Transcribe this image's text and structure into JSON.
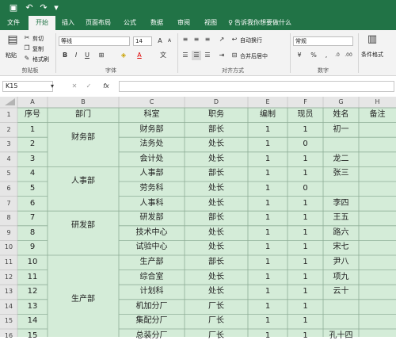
{
  "app": {
    "quick_access": {
      "save_icon": "save-icon",
      "undo_icon": "undo-icon",
      "redo_icon": "redo-icon",
      "customize_icon": "customize-icon"
    }
  },
  "menu": {
    "tabs": [
      "文件",
      "开始",
      "插入",
      "页面布局",
      "公式",
      "数据",
      "审阅",
      "视图"
    ],
    "active": "开始",
    "tellme": "告诉我你想要做什么"
  },
  "ribbon": {
    "clipboard": {
      "paste": "粘贴",
      "cut": "剪切",
      "copy": "复制",
      "painter": "格式刷",
      "label": "剪贴板"
    },
    "font": {
      "name": "等线",
      "size": "14",
      "label": "字体"
    },
    "alignment": {
      "wrap": "自动换行",
      "merge": "合并后居中",
      "label": "对齐方式"
    },
    "number": {
      "format": "常规",
      "label": "数字"
    },
    "styles": {
      "conditional": "条件格式"
    }
  },
  "formula_bar": {
    "name_box": "K15",
    "formula": ""
  },
  "sheet": {
    "columns": [
      "A",
      "B",
      "C",
      "D",
      "E",
      "F",
      "G",
      "H"
    ],
    "row_numbers": [
      "1",
      "2",
      "3",
      "4",
      "5",
      "6",
      "7",
      "8",
      "9",
      "10",
      "11",
      "12",
      "13",
      "14",
      "15",
      "16"
    ],
    "header": [
      "序号",
      "部门",
      "科室",
      "职务",
      "编制",
      "现员",
      "姓名",
      "备注"
    ],
    "rows": [
      [
        "1",
        "",
        "财务部",
        "部长",
        "1",
        "1",
        "初一",
        ""
      ],
      [
        "2",
        "财务部",
        "法务处",
        "处长",
        "1",
        "0",
        "",
        ""
      ],
      [
        "3",
        "",
        "会计处",
        "处长",
        "1",
        "1",
        "龙二",
        ""
      ],
      [
        "4",
        "",
        "人事部",
        "部长",
        "1",
        "1",
        "张三",
        ""
      ],
      [
        "5",
        "人事部",
        "劳务科",
        "处长",
        "1",
        "0",
        "",
        ""
      ],
      [
        "6",
        "",
        "人事科",
        "处长",
        "1",
        "1",
        "李四",
        ""
      ],
      [
        "7",
        "",
        "研发部",
        "部长",
        "1",
        "1",
        "王五",
        ""
      ],
      [
        "8",
        "研发部",
        "技术中心",
        "处长",
        "1",
        "1",
        "路六",
        ""
      ],
      [
        "9",
        "",
        "试验中心",
        "处长",
        "1",
        "1",
        "宋七",
        ""
      ],
      [
        "10",
        "",
        "生产部",
        "部长",
        "1",
        "1",
        "尹八",
        ""
      ],
      [
        "11",
        "",
        "综合室",
        "处长",
        "1",
        "1",
        "项九",
        ""
      ],
      [
        "12",
        "",
        "计划科",
        "处长",
        "1",
        "1",
        "云十",
        ""
      ],
      [
        "13",
        "生产部",
        "机加分厂",
        "厂长",
        "1",
        "1",
        "",
        ""
      ],
      [
        "14",
        "",
        "集配分厂",
        "厂长",
        "1",
        "1",
        "",
        ""
      ],
      [
        "15",
        "",
        "总装分厂",
        "厂长",
        "1",
        "1",
        "孔十四",
        ""
      ]
    ]
  },
  "colors": {
    "accent": "#217346",
    "cell_fill": "#d4ecd8",
    "grid_line": "#8fae97",
    "header_bg": "#e6e6e6"
  }
}
